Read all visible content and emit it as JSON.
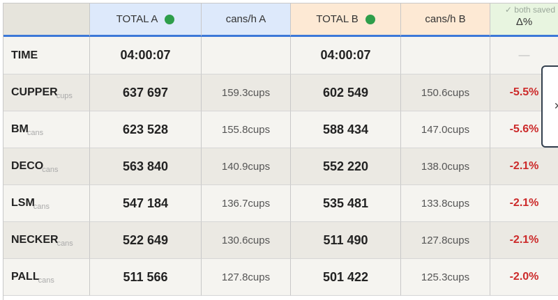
{
  "header": {
    "total_a": "TOTAL A",
    "rate_a": "cans/h A",
    "total_b": "TOTAL B",
    "rate_b": "cans/h B",
    "delta": "Δ%",
    "saved_note": "✓ both saved",
    "status_color": "#2e9e4a"
  },
  "time_row": {
    "label": "TIME",
    "total_a": "04:00:07",
    "total_b": "04:00:07",
    "delta": "—"
  },
  "rows": [
    {
      "label": "CUPPER",
      "unit": "cups",
      "total_a": "637 697",
      "rate_a": "159.3cups",
      "total_b": "602 549",
      "rate_b": "150.6cups",
      "delta": "-5.5%"
    },
    {
      "label": "BM",
      "unit": "cans",
      "total_a": "623 528",
      "rate_a": "155.8cups",
      "total_b": "588 434",
      "rate_b": "147.0cups",
      "delta": "-5.6%"
    },
    {
      "label": "DECO",
      "unit": "cans",
      "total_a": "563 840",
      "rate_a": "140.9cups",
      "total_b": "552 220",
      "rate_b": "138.0cups",
      "delta": "-2.1%"
    },
    {
      "label": "LSM",
      "unit": "cans",
      "total_a": "547 184",
      "rate_a": "136.7cups",
      "total_b": "535 481",
      "rate_b": "133.8cups",
      "delta": "-2.1%"
    },
    {
      "label": "NECKER",
      "unit": "cans",
      "total_a": "522 649",
      "rate_a": "130.6cups",
      "total_b": "511 490",
      "rate_b": "127.8cups",
      "delta": "-2.1%"
    },
    {
      "label": "PALL",
      "unit": "cans",
      "total_a": "511 566",
      "rate_a": "127.8cups",
      "total_b": "501 422",
      "rate_b": "125.3cups",
      "delta": "-2.0%"
    }
  ],
  "popup": {
    "mark": "✕"
  }
}
